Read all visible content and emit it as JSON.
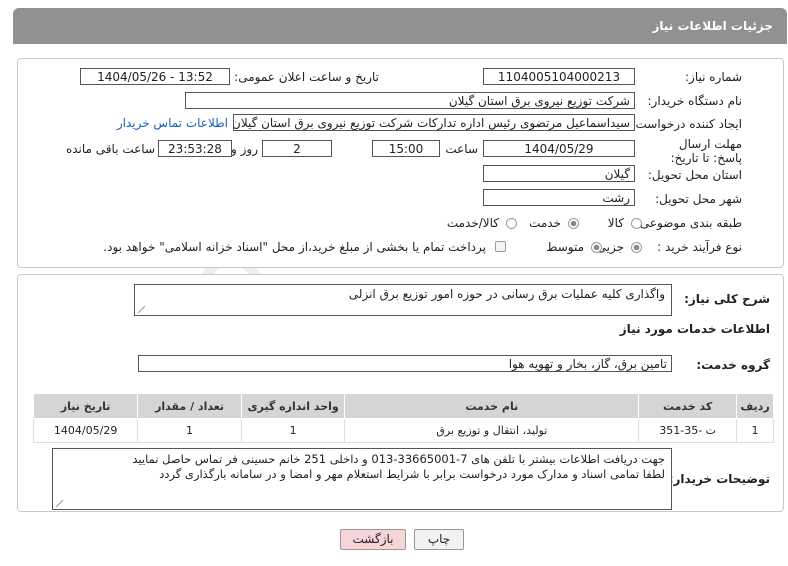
{
  "header": {
    "title": "جزئیات اطلاعات نیاز"
  },
  "fields": {
    "need_number_label": "شماره نیاز:",
    "need_number": "1104005104000213",
    "announce_label": "تاریخ و ساعت اعلان عمومی:",
    "announce_value": "1404/05/26 - 13:52",
    "buyer_label": "نام دستگاه خریدار:",
    "buyer_value": "شرکت توزیع نیروی برق استان گیلان",
    "creator_label": "ایجاد کننده درخواست:",
    "creator_value": "سیداسماعیل مرتضوی رئیس اداره تدارکات شرکت توزیع نیروی برق استان گیلان",
    "contact_link": "اطلاعات تماس خریدار",
    "deadline_label": "مهلت ارسال پاسخ: تا تاریخ:",
    "deadline_date": "1404/05/29",
    "time_label": "ساعت",
    "deadline_time": "15:00",
    "days_value": "2",
    "days_label": "روز و",
    "remaining_time": "23:53:28",
    "remaining_label": "ساعت باقی مانده",
    "province_label": "استان محل تحویل:",
    "province_value": "گیلان",
    "city_label": "شهر محل تحویل:",
    "city_value": "رشت",
    "category_label": "طبقه بندی موضوعی:",
    "category_options": [
      "کالا",
      "خدمت",
      "کالا/خدمت"
    ],
    "category_selected": "خدمت",
    "process_label": "نوع فرآیند خرید :",
    "process_options": [
      "جزیی",
      "متوسط"
    ],
    "process_selected": "جزیی",
    "payment_note": "پرداخت تمام یا بخشی از مبلغ خرید،از محل \"اسناد خزانه اسلامی\" خواهد بود."
  },
  "summary": {
    "label": "شرح کلی نیاز:",
    "value": "واگذاری کلیه عملیات برق رسانی در حوزه امور توزیع برق انزلی"
  },
  "services": {
    "section_title": "اطلاعات خدمات مورد نیاز",
    "group_label": "گروه خدمت:",
    "group_value": "تامین برق، گاز، بخار و تهویه هوا",
    "columns": [
      "ردیف",
      "کد خدمت",
      "نام خدمت",
      "واحد اندازه گیری",
      "تعداد / مقدار",
      "تاریخ نیاز"
    ],
    "rows": [
      {
        "index": "1",
        "code": "ت -35-351",
        "name": "تولید، انتقال و توزیع برق",
        "unit": "1",
        "qty": "1",
        "date": "1404/05/29"
      }
    ]
  },
  "buyer_notes": {
    "label": "توضیحات خریدار:",
    "line1": "جهت دریافت اطلاعات بیشتر با تلفن های 7-33665001-013 و داخلی 251 خانم حسینی فر تماس حاصل نمایید",
    "line2": "لطفا تمامی اسناد و مدارک مورد درخواست برابر با شرایط استعلام مهر و امضا و در سامانه بارگذاری گردد"
  },
  "buttons": {
    "print": "چاپ",
    "back": "بازگشت"
  },
  "watermark": "AriaTender.net",
  "colors": {
    "header_bg": "#8f9192",
    "link": "#1a5fb4",
    "back_button_bg": "#f7d4d7",
    "table_header_bg": "#d5d5d5"
  }
}
